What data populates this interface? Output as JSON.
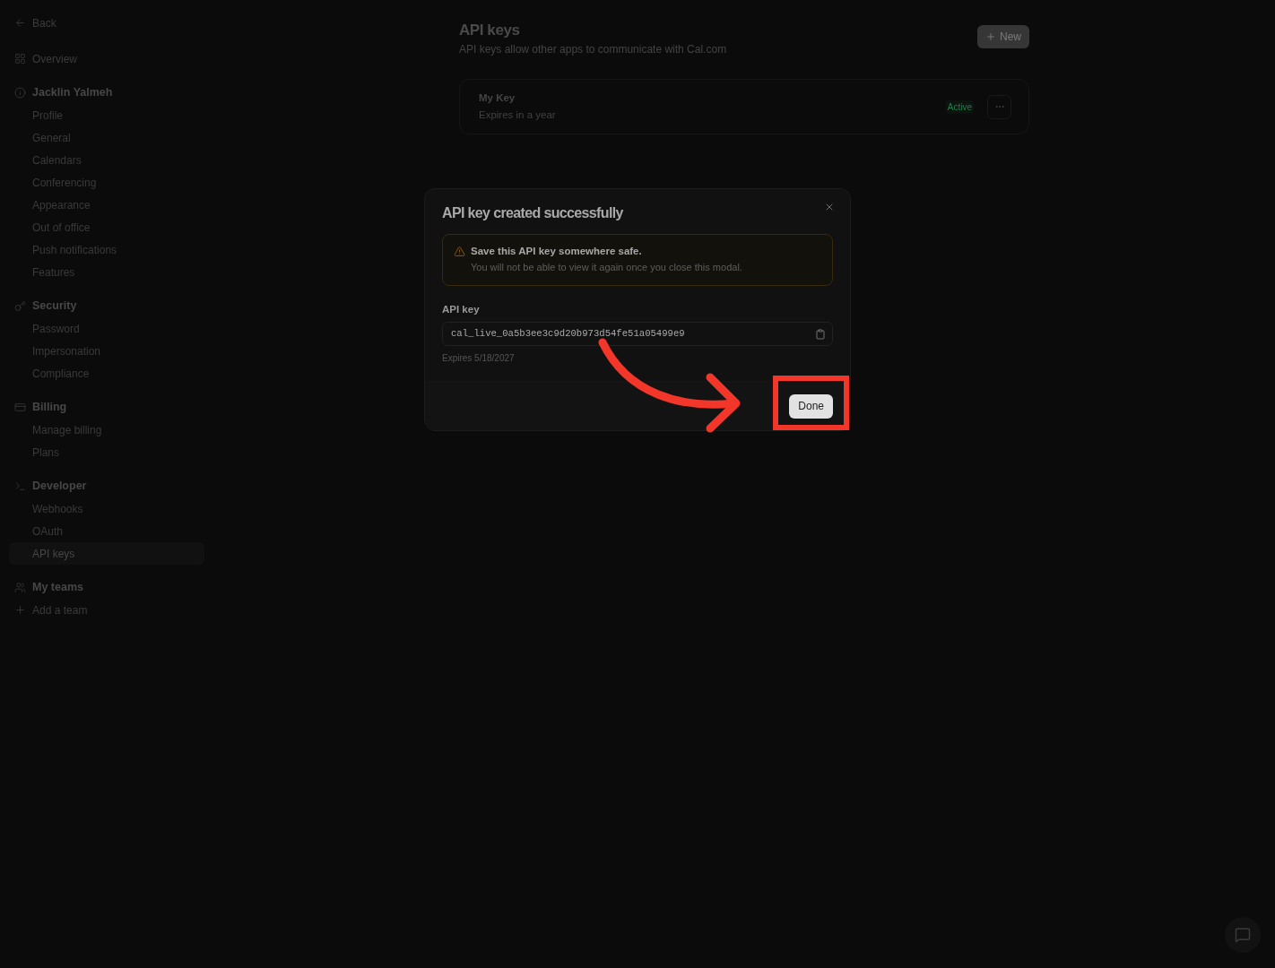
{
  "sidebar": {
    "back": "Back",
    "overview": "Overview",
    "sections": [
      {
        "title": "Jacklin Yalmeh",
        "items": [
          {
            "label": "Profile",
            "selected": false
          },
          {
            "label": "General",
            "selected": false
          },
          {
            "label": "Calendars",
            "selected": false
          },
          {
            "label": "Conferencing",
            "selected": false
          },
          {
            "label": "Appearance",
            "selected": false
          },
          {
            "label": "Out of office",
            "selected": false
          },
          {
            "label": "Push notifications",
            "selected": false
          },
          {
            "label": "Features",
            "selected": false
          }
        ]
      },
      {
        "title": "Security",
        "items": [
          {
            "label": "Password",
            "selected": false
          },
          {
            "label": "Impersonation",
            "selected": false
          },
          {
            "label": "Compliance",
            "selected": false
          }
        ]
      },
      {
        "title": "Billing",
        "items": [
          {
            "label": "Manage billing",
            "selected": false
          },
          {
            "label": "Plans",
            "selected": false
          }
        ]
      },
      {
        "title": "Developer",
        "items": [
          {
            "label": "Webhooks",
            "selected": false
          },
          {
            "label": "OAuth",
            "selected": false
          },
          {
            "label": "API keys",
            "selected": true
          }
        ]
      },
      {
        "title": "My teams"
      }
    ],
    "add_team": "Add a team"
  },
  "page": {
    "title": "API keys",
    "subtitle": "API keys allow other apps to communicate with Cal.com",
    "new_button": "New",
    "keys": [
      {
        "name": "My Key",
        "expiry": "Expires in a year",
        "status": "Active"
      }
    ]
  },
  "modal": {
    "title": "API key created successfully",
    "warning": {
      "title": "Save this API key somewhere safe.",
      "text": "You will not be able to view it again once you close this modal."
    },
    "field_label": "API key",
    "value": "cal_live_0a5b3ee3c9d20b973d54fe51a05499e9",
    "expires": "Expires 5/18/2027",
    "done_button": "Done"
  }
}
